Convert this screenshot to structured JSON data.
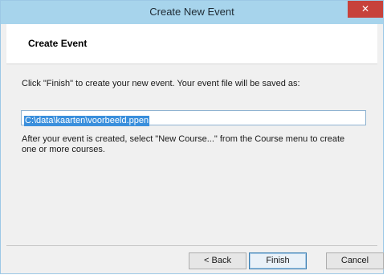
{
  "window": {
    "title": "Create New Event",
    "close_label": "✕"
  },
  "header": {
    "title": "Create Event"
  },
  "content": {
    "instruction": "Click \"Finish\" to create your new event. Your event file will be saved as:",
    "file_path": "C:\\data\\kaarten\\voorbeeld.ppen",
    "after_text": "After your event is created, select \"New Course...\" from the Course menu to create one or more courses."
  },
  "footer": {
    "back_label": "< Back",
    "finish_label": "Finish",
    "cancel_label": "Cancel"
  },
  "colors": {
    "titlebar": "#a7d4ec",
    "close_button": "#c7423b",
    "selection": "#3a8fdc"
  }
}
